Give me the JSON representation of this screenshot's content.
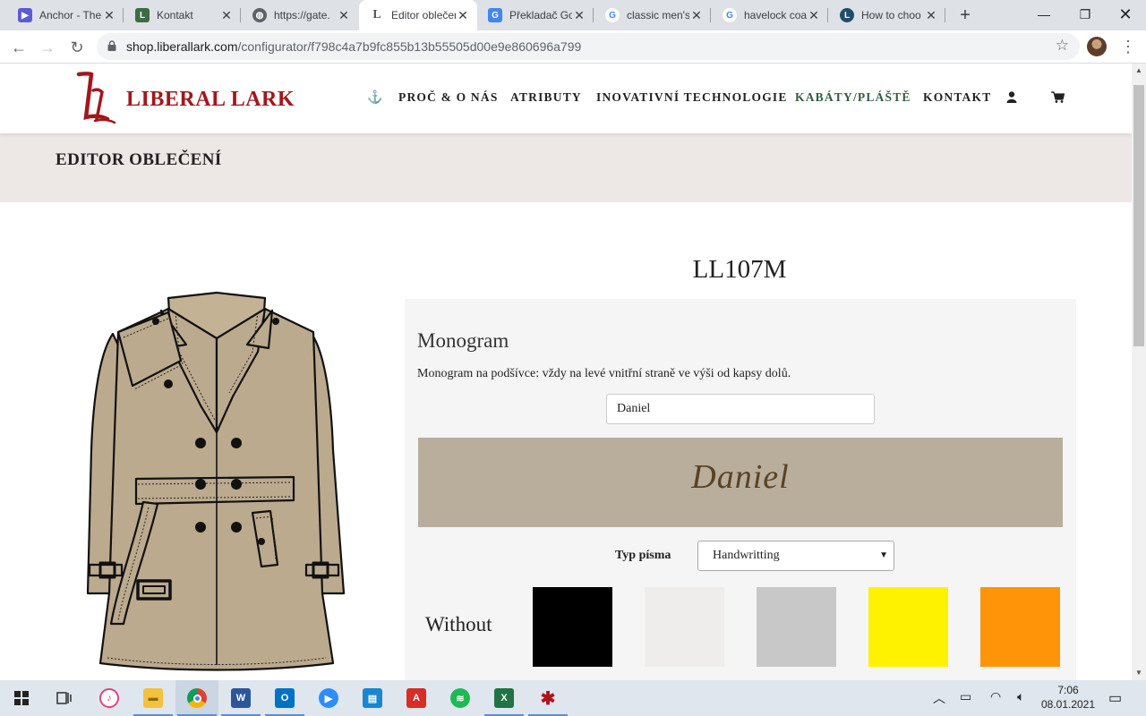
{
  "browser": {
    "tabs": [
      {
        "label": "Anchor - The",
        "icon": "anchor-podcast-icon",
        "color": "#5b5bd6"
      },
      {
        "label": "Kontakt",
        "icon": "liberal-lark-icon",
        "color": "#3e6b46"
      },
      {
        "label": "https://gate.",
        "icon": "globe-icon",
        "color": "#5f6368"
      },
      {
        "label": "Editor oblečení",
        "icon": "liberal-lark-icon",
        "color": "#a3161c",
        "active": true
      },
      {
        "label": "Překladač Go",
        "icon": "google-translate-icon",
        "color": "#4285f4"
      },
      {
        "label": "classic men's",
        "icon": "google-icon",
        "color": "#4285f4"
      },
      {
        "label": "havelock coa",
        "icon": "google-icon",
        "color": "#4285f4"
      },
      {
        "label": "How to choo",
        "icon": "liberal-lark-circle-icon",
        "color": "#1f4e6b"
      }
    ],
    "url_host": "shop.liberallark.com",
    "url_path": "/configurator/f798c4a7b9fc855b13b55505d00e9e860696a799"
  },
  "site": {
    "logo_text": "LIBERAL LARK",
    "nav": [
      {
        "label": "PROČ & O NÁS",
        "active": false
      },
      {
        "label": "ATRIBUTY",
        "active": false
      },
      {
        "label": "INOVATIVNÍ TECHNOLOGIE",
        "active": false
      },
      {
        "label": "KABÁTY/PLÁŠTĚ",
        "active": true
      },
      {
        "label": "KONTAKT",
        "active": false
      }
    ],
    "page_title": "EDITOR OBLEČENÍ"
  },
  "product": {
    "code": "LL107M",
    "monogram": {
      "heading": "Monogram",
      "description": "Monogram na podšívce: vždy na levé vnitřní straně ve výši od kapsy dolů.",
      "input_value": "Daniel",
      "preview_text": "Daniel",
      "font_label": "Typ písma",
      "font_selected": "Handwritting",
      "color_label": "Without",
      "swatches": [
        {
          "name": "black",
          "color": "#000000"
        },
        {
          "name": "white",
          "color": "#efedec"
        },
        {
          "name": "grey",
          "color": "#c8c8c8"
        },
        {
          "name": "yellow",
          "color": "#fff200"
        },
        {
          "name": "orange",
          "color": "#ff9409"
        }
      ]
    }
  },
  "taskbar": {
    "time": "7:06",
    "date": "08.01.2021"
  }
}
